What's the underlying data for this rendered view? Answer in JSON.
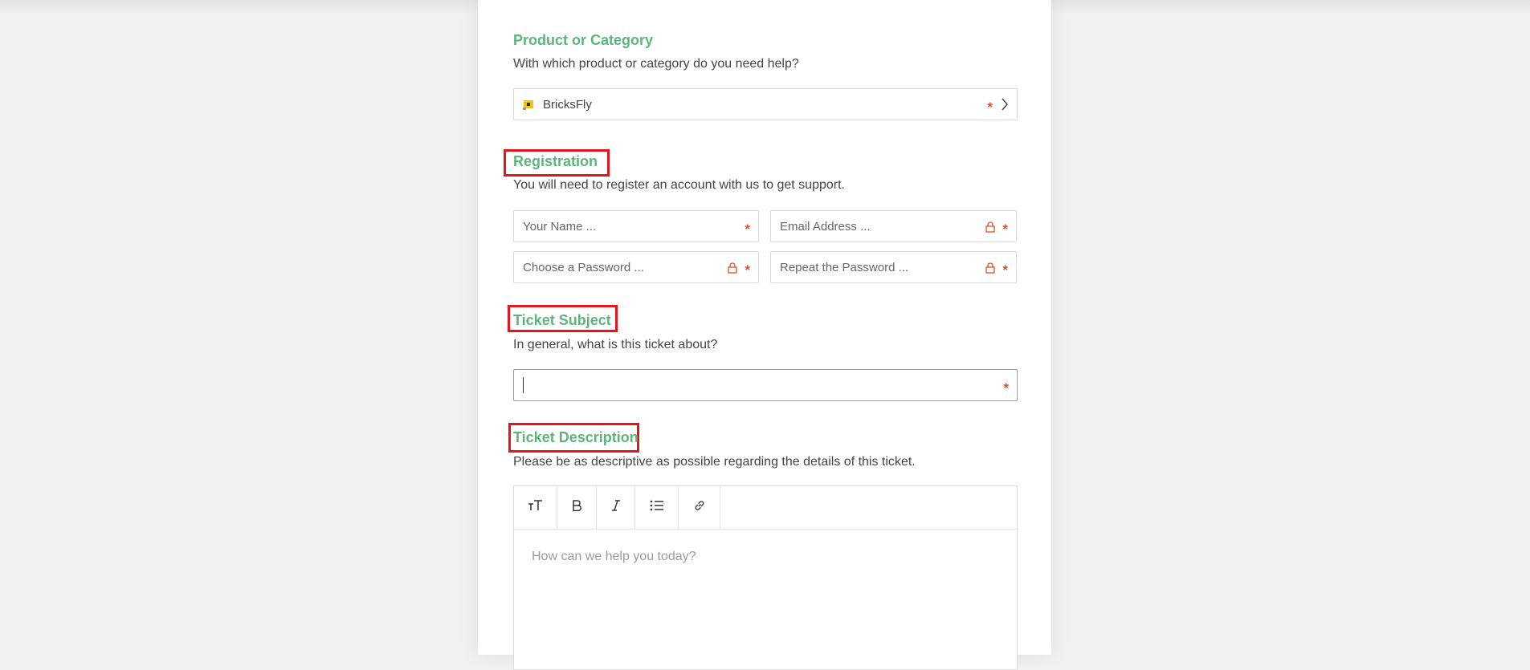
{
  "product_section": {
    "title": "Product or Category",
    "description": "With which product or category do you need help?",
    "selected_value": "BricksFly",
    "required_mark": "*"
  },
  "registration_section": {
    "title": "Registration",
    "description": "You will need to register an account with us to get support.",
    "name_placeholder": "Your Name ...",
    "email_placeholder": "Email Address ...",
    "password_placeholder": "Choose a Password ...",
    "repeat_password_placeholder": "Repeat the Password ...",
    "required_mark": "*"
  },
  "subject_section": {
    "title": "Ticket Subject",
    "description": "In general, what is this ticket about?",
    "value": "",
    "required_mark": "*"
  },
  "description_section": {
    "title": "Ticket Description",
    "description": "Please be as descriptive as possible regarding the details of this ticket.",
    "editor_placeholder": "How can we help you today?",
    "toolbar": [
      "text-size-icon",
      "bold-icon",
      "italic-icon",
      "bullet-list-icon",
      "link-icon"
    ]
  },
  "colors": {
    "accent_green": "#5cb57b",
    "required_red": "#d9532b",
    "highlight_red": "#e4161b"
  }
}
